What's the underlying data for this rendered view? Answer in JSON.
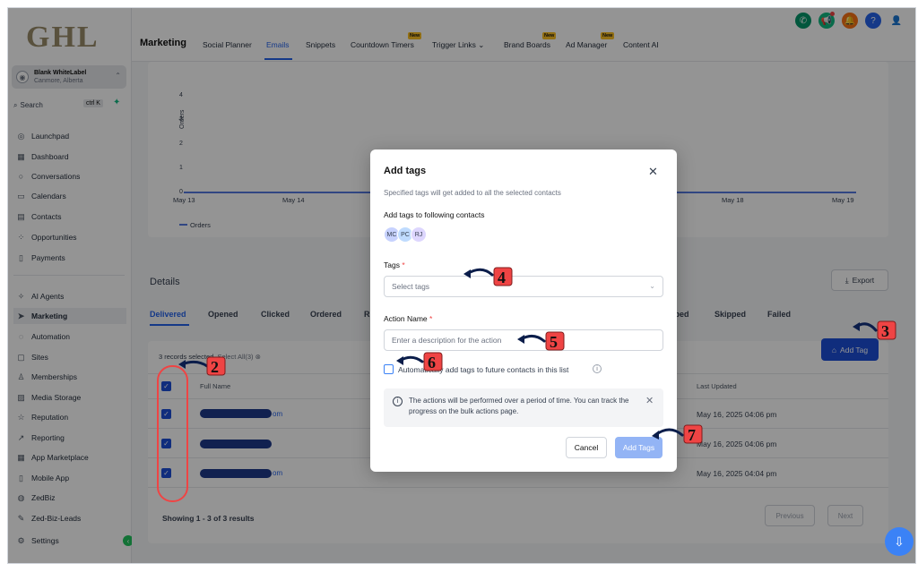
{
  "sidebar": {
    "logo": "GHL",
    "account": {
      "name": "Blank WhiteLabel",
      "location": "Canmore, Alberta"
    },
    "search": {
      "label": "Search",
      "shortcut": "ctrl K"
    },
    "items": [
      {
        "label": "Launchpad",
        "icon": "rocket-icon"
      },
      {
        "label": "Dashboard",
        "icon": "grid-icon"
      },
      {
        "label": "Conversations",
        "icon": "chat-icon"
      },
      {
        "label": "Calendars",
        "icon": "calendar-icon"
      },
      {
        "label": "Contacts",
        "icon": "contacts-icon"
      },
      {
        "label": "Opportunities",
        "icon": "opportunities-icon"
      },
      {
        "label": "Payments",
        "icon": "payments-icon"
      },
      {
        "label": "AI Agents",
        "icon": "sparkle-icon"
      },
      {
        "label": "Marketing",
        "icon": "send-icon"
      },
      {
        "label": "Automation",
        "icon": "automation-icon"
      },
      {
        "label": "Sites",
        "icon": "sites-icon"
      },
      {
        "label": "Memberships",
        "icon": "membership-icon"
      },
      {
        "label": "Media Storage",
        "icon": "image-icon"
      },
      {
        "label": "Reputation",
        "icon": "star-icon"
      },
      {
        "label": "Reporting",
        "icon": "trend-icon"
      },
      {
        "label": "App Marketplace",
        "icon": "apps-icon"
      },
      {
        "label": "Mobile App",
        "icon": "mobile-icon"
      },
      {
        "label": "ZedBiz",
        "icon": "zedbiz-icon"
      },
      {
        "label": "Zed-Biz-Leads",
        "icon": "wrench-icon"
      },
      {
        "label": "Settings",
        "icon": "gear-icon"
      }
    ]
  },
  "topbar": {
    "title": "Marketing",
    "tabs": [
      "Social Planner",
      "Emails",
      "Snippets",
      "Countdown Timers",
      "Trigger Links",
      "Brand Boards",
      "Ad Manager",
      "Content AI"
    ],
    "new_badge": "New"
  },
  "chart": {
    "ylabel": "Orders",
    "yticks": [
      "0",
      "1",
      "2",
      "3",
      "4"
    ],
    "xticks": [
      "May 13",
      "May 14",
      "May 18",
      "May 19"
    ],
    "legend": "Orders"
  },
  "details": {
    "title": "Details",
    "export_label": "Export",
    "tabs": [
      "Delivered",
      "Opened",
      "Clicked",
      "Ordered",
      "R",
      "ibed",
      "Skipped",
      "Failed"
    ],
    "add_tag_label": "Add Tag",
    "records_selected": "3 records selected",
    "select_all": "Select All(3)",
    "columns": {
      "name": "Full Name",
      "updated": "Last Updated"
    },
    "rows": [
      {
        "name_tail": "om",
        "updated": "May 16, 2025 04:06 pm"
      },
      {
        "name_tail": "",
        "updated": "May 16, 2025 04:06 pm"
      },
      {
        "name_tail": "om",
        "updated": "May 16, 2025 04:04 pm"
      }
    ],
    "showing": "Showing 1 - 3 of 3 results",
    "prev": "Previous",
    "next": "Next"
  },
  "modal": {
    "title": "Add tags",
    "subtitle": "Specified tags will get added to all the selected contacts",
    "contacts_label": "Add tags to following contacts",
    "chips": [
      "MC",
      "PC",
      "RJ"
    ],
    "tags_label": "Tags",
    "tags_placeholder": "Select tags",
    "action_label": "Action Name",
    "action_placeholder": "Enter a description for the action",
    "auto_label": "Automatically add tags to future contacts in this list",
    "info_text": "The actions will be performed over a period of time. You can track the progress on the bulk actions page.",
    "cancel": "Cancel",
    "submit": "Add Tags"
  },
  "markers": [
    "2",
    "3",
    "4",
    "5",
    "6",
    "7"
  ],
  "colors": {
    "primary": "#1d4ed8",
    "accent_blue": "#2563eb",
    "annotation_red": "#ef4444"
  }
}
